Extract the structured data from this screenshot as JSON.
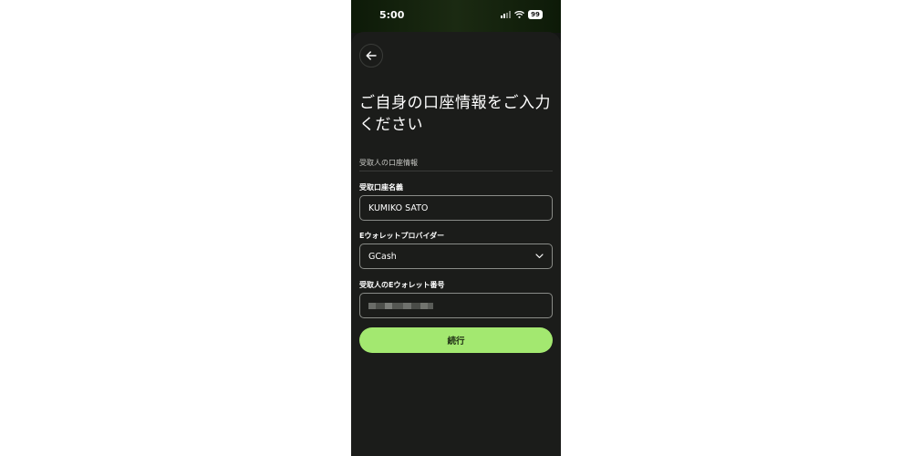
{
  "status_bar": {
    "time": "5:00",
    "battery": "99",
    "icons": [
      "signal-icon",
      "wifi-icon",
      "battery-icon"
    ]
  },
  "header": {
    "back_icon": "arrow-left-icon",
    "title": "ご自身の口座情報をご入力ください"
  },
  "form": {
    "section_label": "受取人の口座情報",
    "account_name": {
      "label": "受取口座名義",
      "value": "KUMIKO SATO"
    },
    "provider": {
      "label": "Eウォレットプロバイダー",
      "selected": "GCash",
      "icon": "chevron-down-icon"
    },
    "wallet_number": {
      "label": "受取人のEウォレット番号",
      "value": ""
    },
    "submit_label": "続行"
  },
  "colors": {
    "background": "#1b1c1a",
    "accent": "#a3e870",
    "field_border": "#8a8c88"
  }
}
